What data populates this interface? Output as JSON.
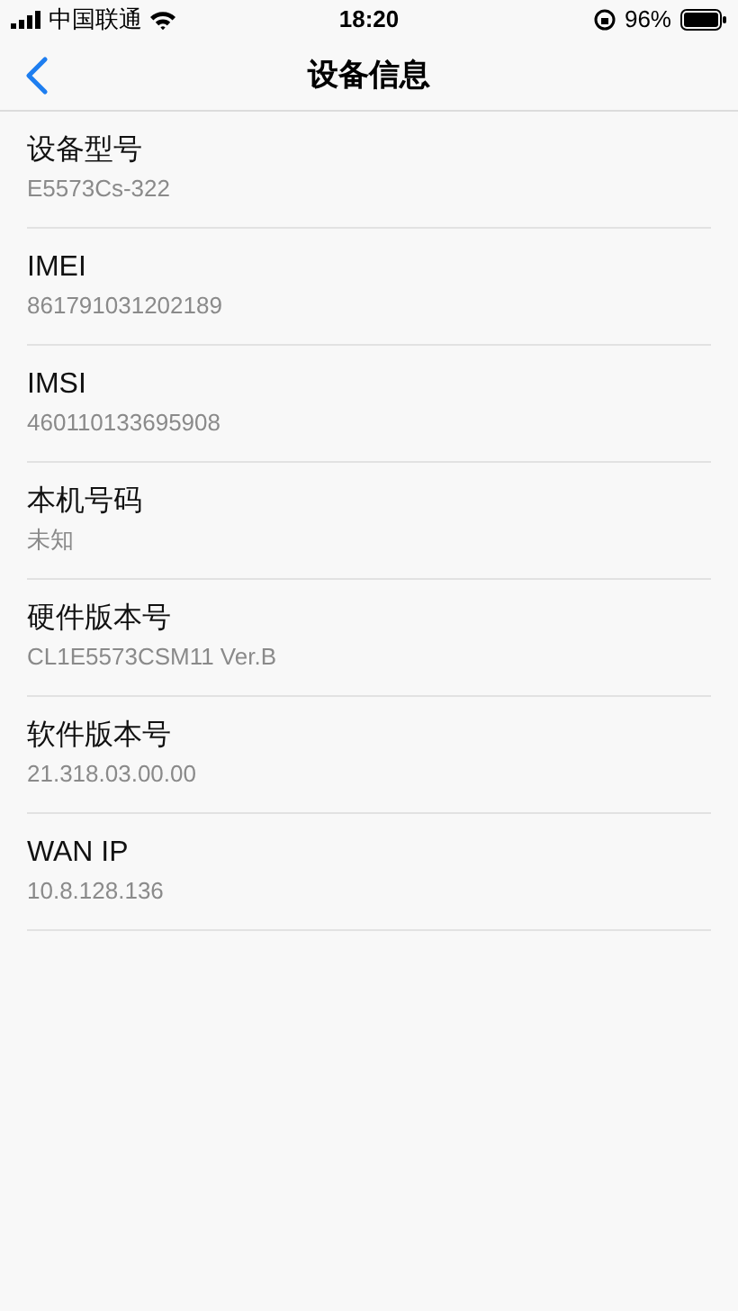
{
  "status_bar": {
    "carrier": "中国联通",
    "time": "18:20",
    "battery": "96%"
  },
  "nav_bar": {
    "title": "设备信息"
  },
  "items": [
    {
      "label": "设备型号",
      "value": "E5573Cs-322"
    },
    {
      "label": "IMEI",
      "value": "861791031202189"
    },
    {
      "label": "IMSI",
      "value": "460110133695908"
    },
    {
      "label": "本机号码",
      "value": "未知"
    },
    {
      "label": "硬件版本号",
      "value": "CL1E5573CSM11 Ver.B"
    },
    {
      "label": "软件版本号",
      "value": "21.318.03.00.00"
    },
    {
      "label": "WAN IP",
      "value": "10.8.128.136"
    }
  ]
}
